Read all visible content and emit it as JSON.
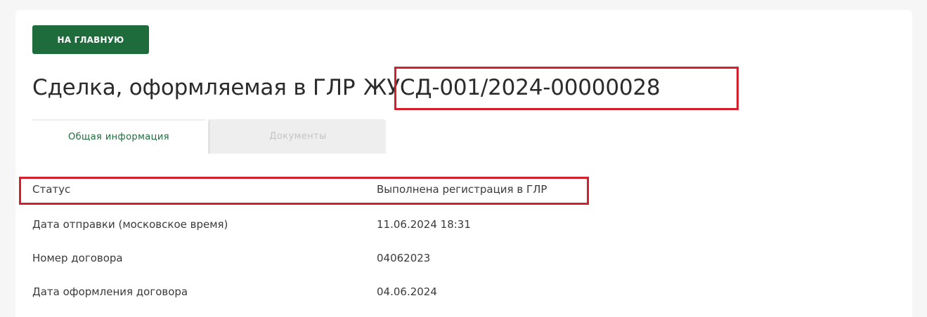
{
  "home_button": {
    "label": "НА ГЛАВНУЮ"
  },
  "page": {
    "title_prefix": "Сделка, оформляемая в ГЛР",
    "deal_number": "ЖУСД-001/2024-00000028"
  },
  "tabs": [
    {
      "label": "Общая информация",
      "active": true
    },
    {
      "label": "Документы",
      "active": false
    }
  ],
  "details": [
    {
      "label": "Статус",
      "value": "Выполнена регистрация в ГЛР"
    },
    {
      "label": "Дата отправки (московское время)",
      "value": "11.06.2024 18:31"
    },
    {
      "label": "Номер договора",
      "value": "04062023"
    },
    {
      "label": "Дата оформления договора",
      "value": "04.06.2024"
    }
  ],
  "colors": {
    "accent": "#1e6b3c",
    "highlight": "#d61f2c"
  }
}
